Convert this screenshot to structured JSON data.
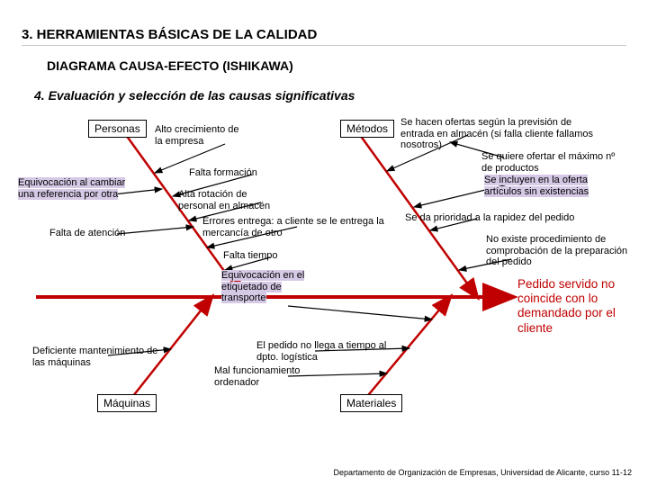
{
  "titles": {
    "l1": "3. HERRAMIENTAS BÁSICAS DE LA CALIDAD",
    "l2": "DIAGRAMA CAUSA-EFECTO (ISHIKAWA)",
    "l3": "4. Evaluación y selección de las causas significativas"
  },
  "categories": {
    "personas": "Personas",
    "metodos": "Métodos",
    "maquinas": "Máquinas",
    "materiales": "Materiales"
  },
  "effect": "Pedido servido no coincide con lo demandado por el cliente",
  "causes": {
    "p_equiv": "Equivocación al cambiar una referencia por otra",
    "p_atencion": "Falta de atención",
    "p_crec": "Alto crecimiento de la empresa",
    "p_form": "Falta formación",
    "p_rot": "Alta rotación de personal en almacén",
    "p_err": "Errores entrega: a cliente se le entrega la mercancía de otro",
    "p_tiempo": "Falta tiempo",
    "m_ofertas": "Se hacen ofertas según la previsión de entrada en almacén (si falla cliente fallamos nosotros)",
    "m_max": "Se quiere ofertar el máximo nº de productos",
    "m_incluyen": "Se incluyen en la oferta artículos sin existencias",
    "m_prioridad": "Se da prioridad a la rapidez del pedido",
    "m_noproc": "No existe procedimiento de comprobación de la preparación del pedido",
    "mt_etiq": "Equivocación en el etiquetado de transporte",
    "mt_nollega": "El pedido no llega a tiempo al dpto. logística",
    "mt_ord": "Mal funcionamiento ordenador",
    "mq_mant": "Deficiente mantenimiento de las máquinas"
  },
  "footer": "Departamento de Organización de Empresas, Universidad de Alicante, curso 11-12"
}
